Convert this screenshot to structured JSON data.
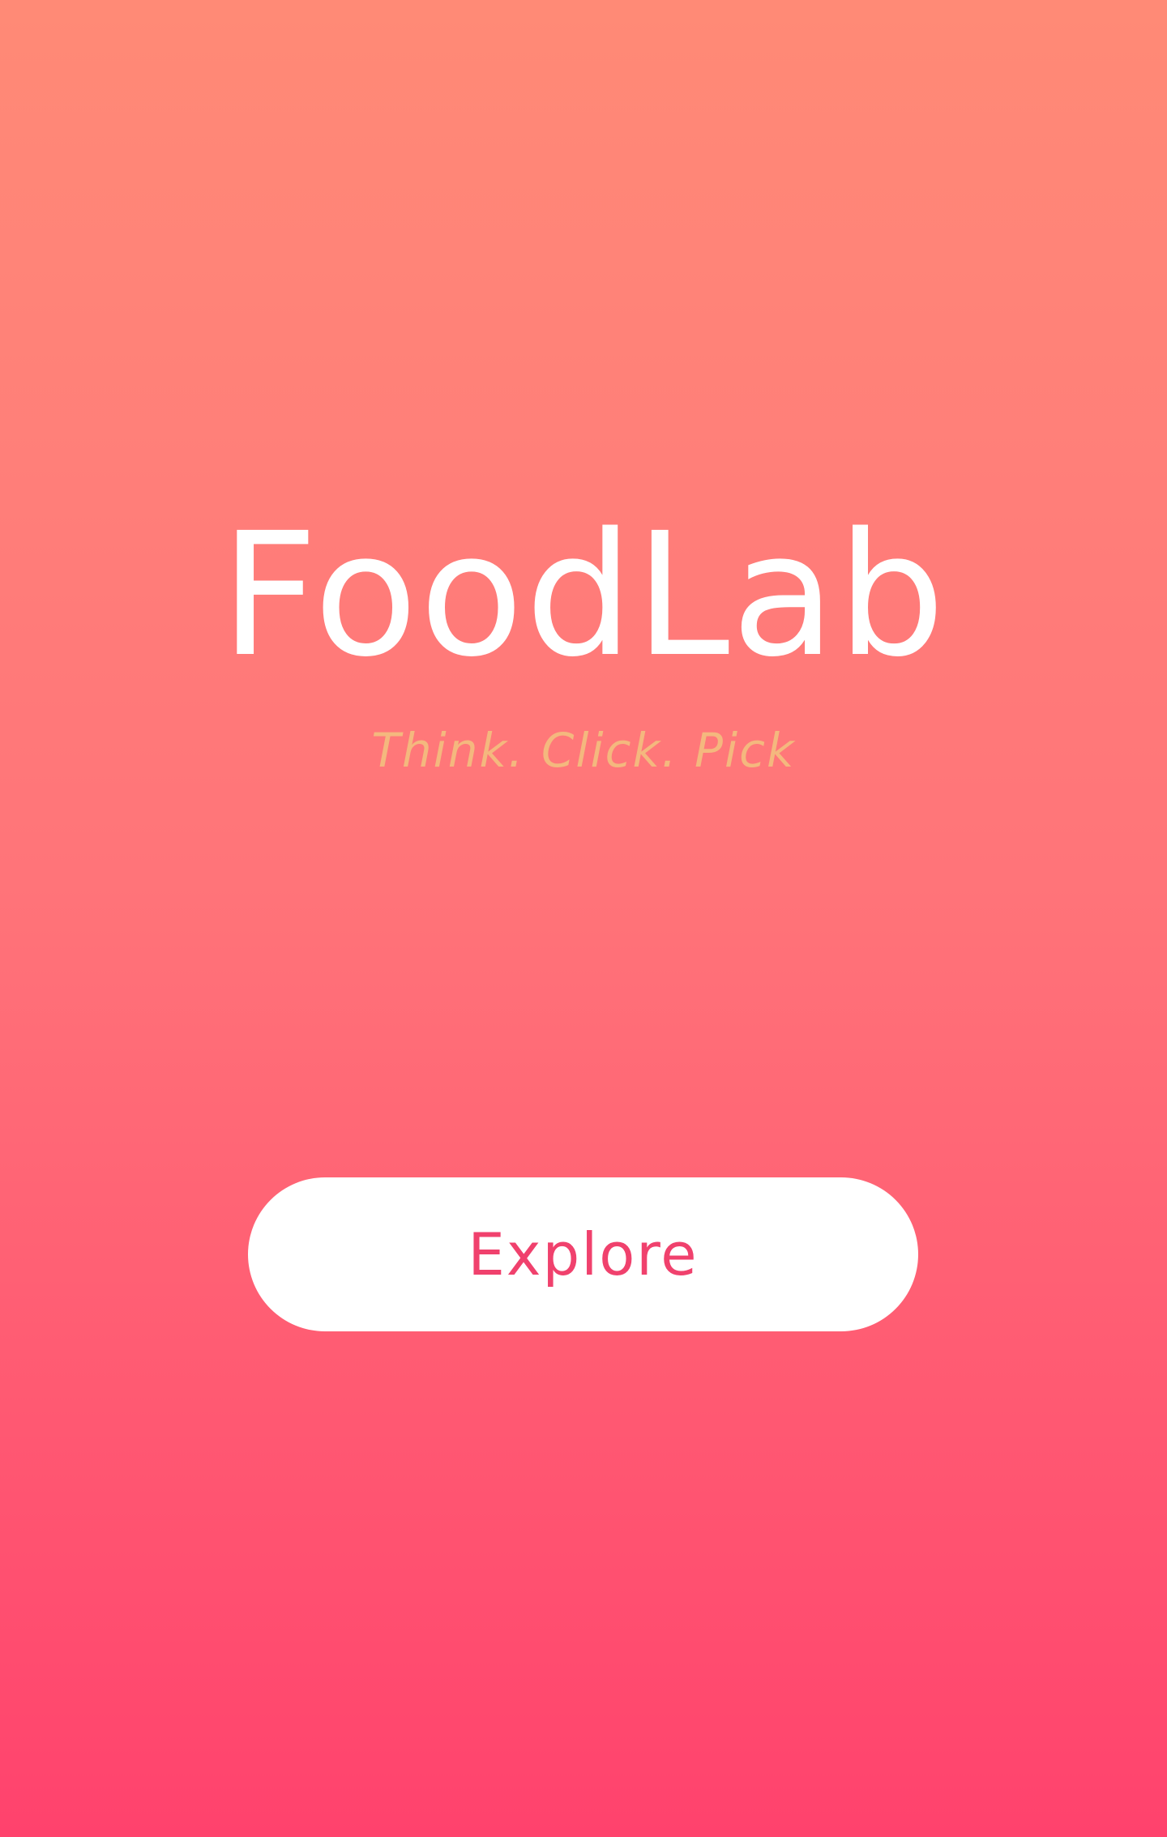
{
  "app": {
    "title": "FoodLab",
    "tagline": "Think. Click. Pick"
  },
  "actions": {
    "explore_label": "Explore"
  },
  "colors": {
    "gradient_top": "#ff8a76",
    "gradient_bottom": "#ff426d",
    "title": "#ffffff",
    "tagline": "#f4b87e",
    "button_background": "#ffffff",
    "button_text": "#f0416d"
  }
}
